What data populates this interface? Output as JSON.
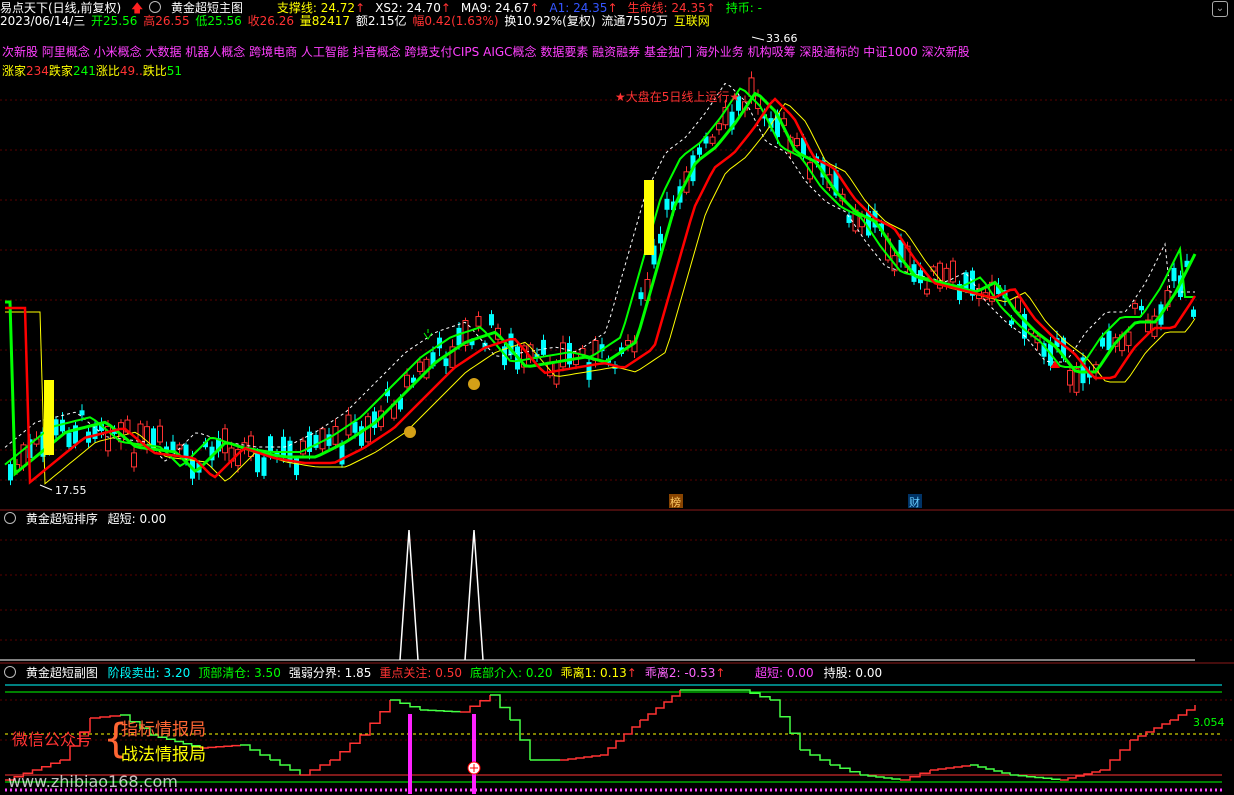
{
  "header": {
    "app_title": "易点天下(日线,前复权)",
    "indicator_name": "黄金超短主图",
    "line1": [
      {
        "label": "支撑线: 24.72",
        "color": "#ffff00"
      },
      {
        "label": "XS2: 24.70",
        "color": "#ffffff"
      },
      {
        "label": "MA9: 24.67",
        "color": "#ffffff"
      },
      {
        "label": "A1: 24.35",
        "color": "#3355ff"
      },
      {
        "label": "生命线: 24.35",
        "color": "#ff3333"
      },
      {
        "label": "持币: -",
        "color": "#00ff00"
      }
    ]
  },
  "quote": {
    "date": "2023/06/14/三",
    "open": "开25.56",
    "high": "高26.55",
    "low": "低25.56",
    "close": "收26.26",
    "volume": "量82417",
    "amount": "额2.15亿",
    "change": "幅0.42(1.63%)",
    "turnover": "换10.92%(复权)",
    "float": "流通7550万",
    "sector": "互联网"
  },
  "concepts": "次新股 阿里概念 小米概念 大数据 机器人概念 跨境电商 人工智能 抖音概念 跨境支付CIPS AIGC概念 数据要素 融资融券 基金独门 海外业务 机构吸筹 深股通标的 中证1000 深次新股",
  "breadth": {
    "up_label": "涨家",
    "up_value": "234",
    "down_label": "跌家",
    "down_value": "241",
    "up_ratio_label": "涨比",
    "up_ratio_value": "49",
    "down_ratio_label": "跌比",
    "down_ratio_value": "51"
  },
  "main_chart": {
    "annotation": "★大盘在5日线上运行★",
    "high_label": "33.66",
    "low_label": "17.55",
    "marker_bang": "榜",
    "marker_cai": "财"
  },
  "panel2": {
    "title": "黄金超短排序",
    "value_label": "超短: 0.00"
  },
  "panel3": {
    "title": "黄金超短副图",
    "items": [
      {
        "label": "阶段卖出: 3.20",
        "color": "#00ffff"
      },
      {
        "label": "顶部清仓: 3.50",
        "color": "#00ff00"
      },
      {
        "label": "强弱分界: 1.85",
        "color": "#ffffff"
      },
      {
        "label": "重点关注: 0.50",
        "color": "#ff3333"
      },
      {
        "label": "底部介入: 0.20",
        "color": "#00ff00"
      },
      {
        "label": "乖离1: 0.13",
        "color": "#ffff00"
      },
      {
        "label": "乖离2: -0.53",
        "color": "#ff66ff"
      }
    ],
    "right_items": [
      {
        "label": "超短: 0.00",
        "color": "#ff44ff"
      },
      {
        "label": "持股: 0.00",
        "color": "#ffffff"
      }
    ],
    "right_value": "3.054",
    "watermark_wechat": "微信公众号",
    "watermark_line1": "指标情报局",
    "watermark_line2": "战法情报局",
    "watermark_url": "www.zhibiao168.com"
  },
  "colors": {
    "up": "#ff3232",
    "down": "#00ffff",
    "ma_green": "#00ff00",
    "ma_red": "#ff0000",
    "ma_yellow": "#ffff00",
    "divider": "#8b1a1a"
  }
}
